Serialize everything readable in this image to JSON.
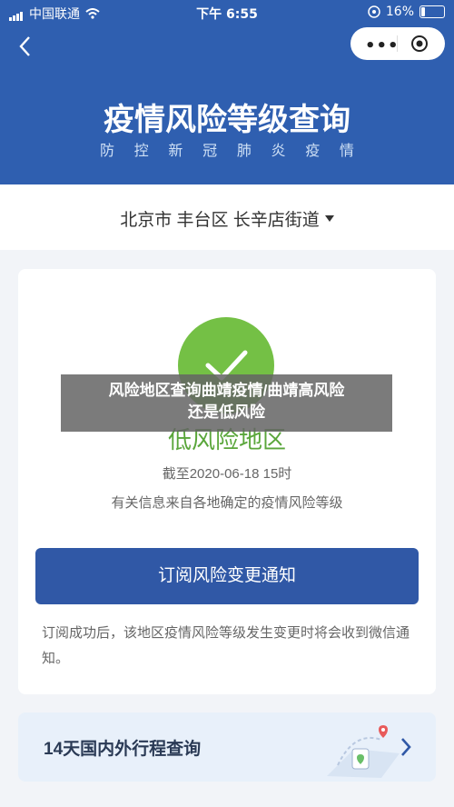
{
  "status_bar": {
    "carrier": "中国联通",
    "time": "下午 6:55",
    "battery_percent": "16%",
    "battery_level": 0.16
  },
  "nav": {
    "more_icon": "more-dots-icon",
    "close_icon": "target-icon"
  },
  "header": {
    "title": "疫情风险等级查询",
    "subtitle_chars": [
      "防",
      "控",
      "新",
      "冠",
      "肺",
      "炎",
      "疫",
      "情"
    ]
  },
  "location": {
    "label": "北京市 丰台区 长辛店街道"
  },
  "risk_card": {
    "level": "低风险地区",
    "as_of": "截至2020-06-18 15时",
    "source": "有关信息来自各地确定的疫情风险等级",
    "subscribe_label": "订阅风险变更通知",
    "note": "订阅成功后，该地区疫情风险等级发生变更时将会收到微信通知。"
  },
  "banner": {
    "label": "14天国内外行程查询"
  },
  "overlay": {
    "line1": "风险地区查询曲靖疫情/曲靖高风险",
    "line2": "还是低风险"
  },
  "colors": {
    "header_bg": "#2f5fb0",
    "button_bg": "#3058a6",
    "low_risk_green": "#74c045"
  }
}
